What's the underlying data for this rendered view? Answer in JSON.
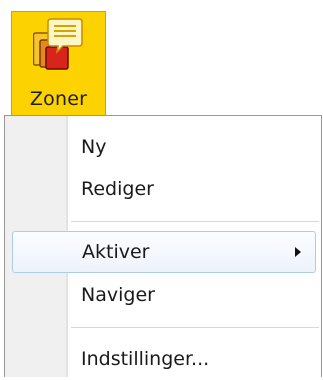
{
  "ribbon_button": {
    "label": "Zoner",
    "icon": "zones-icon"
  },
  "menu": {
    "items": [
      {
        "label": "Ny"
      },
      {
        "label": "Rediger"
      },
      {
        "label": "Aktiver",
        "submenu": true,
        "highlighted": true
      },
      {
        "label": "Naviger"
      },
      {
        "label": "Indstillinger..."
      }
    ]
  },
  "colors": {
    "ribbon_button_bg": "#fdd201",
    "menu_gutter": "#f0f0f0",
    "menu_border": "#979797",
    "highlight_border": "#aecbe9"
  }
}
